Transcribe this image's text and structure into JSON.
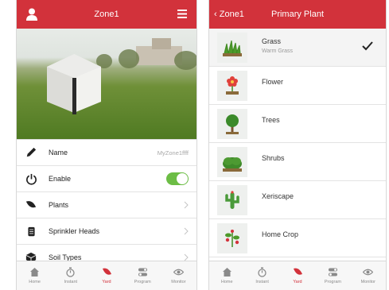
{
  "left": {
    "header": {
      "title": "Zone1"
    },
    "settings": [
      {
        "icon": "pencil-icon",
        "label": "Name",
        "value": "MyZone1ffff"
      },
      {
        "icon": "power-icon",
        "label": "Enable",
        "toggle": true
      },
      {
        "icon": "leaf-icon",
        "label": "Plants"
      },
      {
        "icon": "sprinkler-head-icon",
        "label": "Sprinkler Heads"
      },
      {
        "icon": "cube-icon",
        "label": "Soil Types"
      }
    ]
  },
  "right": {
    "header": {
      "back_label": "Zone1",
      "title": "Primary Plant"
    },
    "plants": [
      {
        "name": "Grass",
        "subtitle": "Warm Grass",
        "selected": true,
        "icon": "grass-icon"
      },
      {
        "name": "Flower",
        "icon": "flower-icon"
      },
      {
        "name": "Trees",
        "icon": "tree-icon"
      },
      {
        "name": "Shrubs",
        "icon": "shrub-icon"
      },
      {
        "name": "Xeriscape",
        "icon": "cactus-icon"
      },
      {
        "name": "Home Crop",
        "icon": "crop-icon"
      }
    ]
  },
  "tabs": [
    {
      "label": "Home",
      "icon": "home-icon"
    },
    {
      "label": "Instant",
      "icon": "stopwatch-icon"
    },
    {
      "label": "Yard",
      "icon": "yard-leaf-icon",
      "active": true
    },
    {
      "label": "Program",
      "icon": "program-icon"
    },
    {
      "label": "Monitor",
      "icon": "eye-icon"
    }
  ],
  "colors": {
    "brand": "#d2323b",
    "toggle_on": "#6cbd45"
  }
}
